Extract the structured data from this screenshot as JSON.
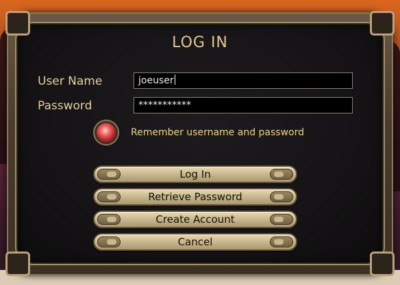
{
  "dialog": {
    "title": "LOG IN"
  },
  "form": {
    "username_label": "User Name",
    "username_value": "joeuser",
    "password_label": "Password",
    "password_value": "***********",
    "remember_label": "Remember username and password",
    "remember_checked": true
  },
  "buttons": {
    "login": "Log In",
    "retrieve": "Retrieve Password",
    "create": "Create Account",
    "cancel": "Cancel"
  },
  "colors": {
    "title": "#e6c694",
    "label": "#e8cfa0",
    "remember_text": "#f2cf8e",
    "button_face": "#cbbb90",
    "frame_border": "#a58f67",
    "radio_active": "#f2645e"
  }
}
